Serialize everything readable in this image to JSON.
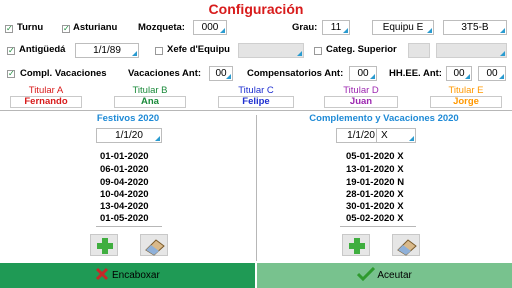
{
  "title": "Configuración",
  "row1": {
    "turnu": {
      "label": "Turnu",
      "checked": true
    },
    "asturianu": {
      "label": "Asturianu",
      "checked": true
    },
    "mozqueta": {
      "label": "Mozqueta:",
      "value": "000"
    },
    "grau": {
      "label": "Grau:",
      "value": "11"
    },
    "equipu": {
      "value": "Equipu E"
    },
    "turno_code": {
      "value": "3T5-B"
    }
  },
  "row2": {
    "antiguedad": {
      "label": "Antigüedá",
      "checked": true,
      "value": "1/1/89"
    },
    "xefe": {
      "label": "Xefe d'Equipu",
      "checked": false,
      "value": ""
    },
    "categ": {
      "label": "Categ. Superior",
      "checked": false,
      "value": ""
    }
  },
  "row3": {
    "compl": {
      "label": "Compl. Vacaciones",
      "checked": true
    },
    "vac_ant": {
      "label": "Vacaciones Ant:",
      "value": "00"
    },
    "comp_ant": {
      "label": "Compensatorios Ant:",
      "value": "00"
    },
    "hhee": {
      "label": "HH.EE. Ant:",
      "value1": "00",
      "value2": "00"
    }
  },
  "titulares": [
    {
      "head": "Titular A",
      "name": "Fernando",
      "color": "#d81b1b"
    },
    {
      "head": "Titular B",
      "name": "Ana",
      "color": "#1a8a3a"
    },
    {
      "head": "Titular C",
      "name": "Felipe",
      "color": "#1e2fd0"
    },
    {
      "head": "Titular D",
      "name": "Juan",
      "color": "#9c27b0"
    },
    {
      "head": "Titular E",
      "name": "Jorge",
      "color": "#ff9800"
    }
  ],
  "festivos": {
    "title": "Festivos 2020",
    "date": "1/1/20",
    "items": [
      "01-01-2020",
      "06-01-2020",
      "09-04-2020",
      "10-04-2020",
      "13-04-2020",
      "01-05-2020"
    ]
  },
  "complemento": {
    "title": "Complemento y Vacaciones 2020",
    "date": "1/1/20",
    "type": "X",
    "items": [
      "05-01-2020 X",
      "13-01-2020 X",
      "19-01-2020 N",
      "28-01-2020 X",
      "30-01-2020 X",
      "05-02-2020 X"
    ]
  },
  "buttons": {
    "cancel": "Encaboxar",
    "accept": "Aceutar"
  },
  "colors": {
    "title": "#d81b1b",
    "accent": "#1e8ad6",
    "cancel_bg": "#1f9a55",
    "accept_bg": "#78c28e",
    "corner": "#2a9bd0"
  }
}
